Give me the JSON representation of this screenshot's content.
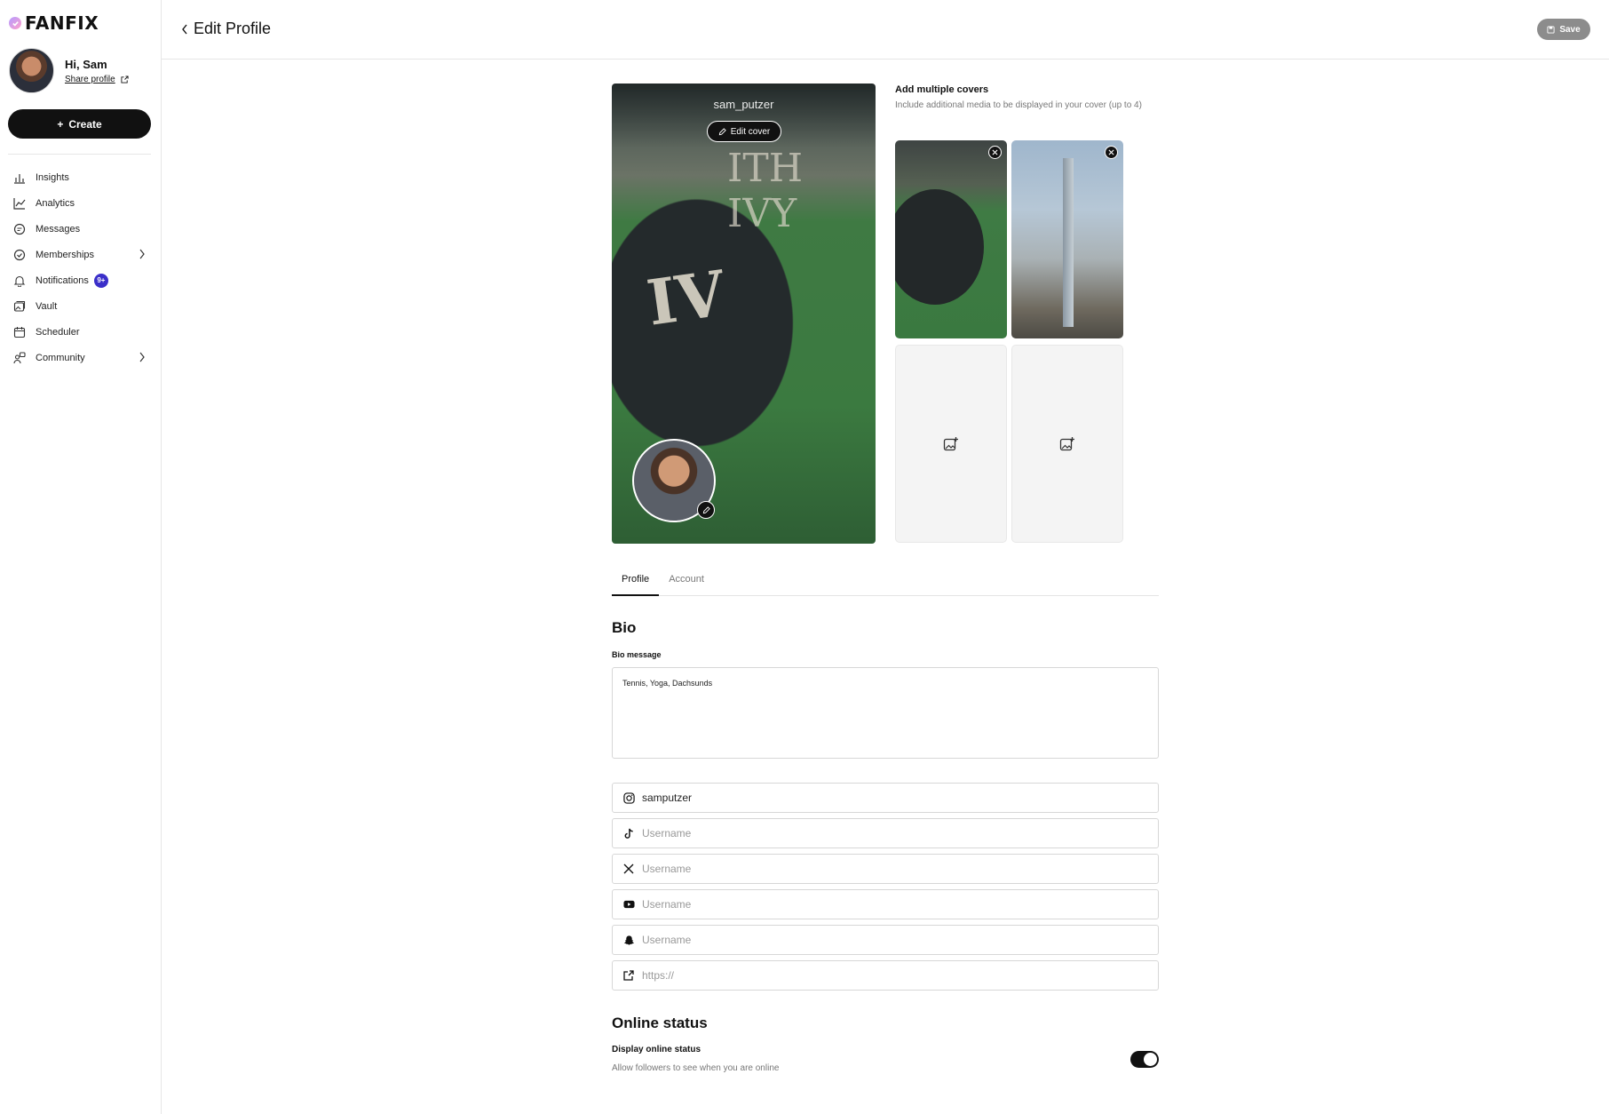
{
  "app": {
    "name": "FANFIX"
  },
  "user": {
    "greeting": "Hi, Sam",
    "share_label": "Share profile"
  },
  "sidebar": {
    "create_label": "Create",
    "items": [
      {
        "label": "Insights",
        "icon": "bar-chart-icon"
      },
      {
        "label": "Analytics",
        "icon": "line-chart-icon"
      },
      {
        "label": "Messages",
        "icon": "chat-icon"
      },
      {
        "label": "Memberships",
        "icon": "badge-check-icon",
        "chevron": true
      },
      {
        "label": "Notifications",
        "icon": "bell-icon",
        "badge": "9+"
      },
      {
        "label": "Vault",
        "icon": "images-icon"
      },
      {
        "label": "Scheduler",
        "icon": "calendar-icon"
      },
      {
        "label": "Community",
        "icon": "users-icon",
        "chevron": true
      }
    ]
  },
  "header": {
    "title": "Edit Profile",
    "save_label": "Save"
  },
  "cover": {
    "username": "sam_putzer",
    "edit_cover_label": "Edit cover"
  },
  "multiple_covers": {
    "title": "Add multiple covers",
    "description": "Include additional media to be displayed in your cover (up to 4)"
  },
  "tabs": [
    {
      "label": "Profile",
      "active": true
    },
    {
      "label": "Account",
      "active": false
    }
  ],
  "bio": {
    "heading": "Bio",
    "label": "Bio message",
    "value": "Tennis, Yoga, Dachsunds"
  },
  "socials": [
    {
      "icon": "instagram-icon",
      "value": "samputzer",
      "placeholder": "Username"
    },
    {
      "icon": "tiktok-icon",
      "value": "",
      "placeholder": "Username"
    },
    {
      "icon": "x-icon",
      "value": "",
      "placeholder": "Username"
    },
    {
      "icon": "youtube-icon",
      "value": "",
      "placeholder": "Username"
    },
    {
      "icon": "snapchat-icon",
      "value": "",
      "placeholder": "Username"
    },
    {
      "icon": "external-link-icon",
      "value": "",
      "placeholder": "https://"
    }
  ],
  "online_status": {
    "heading": "Online status",
    "label": "Display online status",
    "description": "Allow followers to see when you are online",
    "enabled": true
  },
  "colors": {
    "accent": "#111111",
    "badge": "#3b2fc9",
    "save_disabled": "#8c8c8c"
  }
}
